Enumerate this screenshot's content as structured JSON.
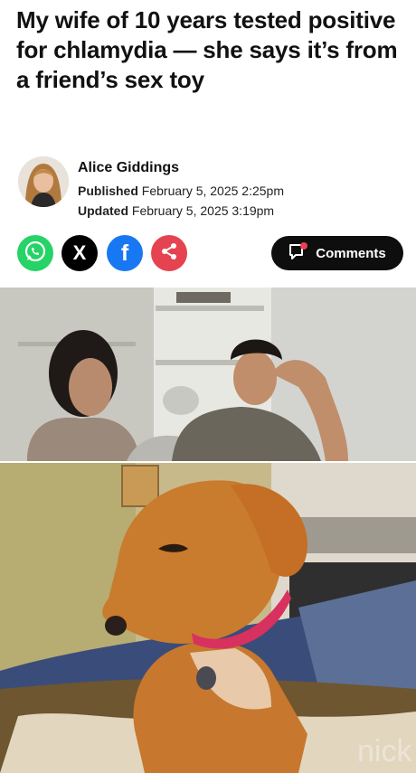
{
  "article": {
    "headline": "My wife of 10 years tested positive for chlamydia — she says it’s from a friend’s sex toy",
    "author": "Alice Giddings",
    "published_label": "Published",
    "published_date": "February 5, 2025 2:25pm",
    "updated_label": "Updated",
    "updated_date": "February 5, 2025 3:19pm"
  },
  "share": {
    "icons": [
      "whatsapp-icon",
      "x-icon",
      "facebook-icon",
      "share-icon"
    ],
    "colors": {
      "whatsapp": "#25d366",
      "x": "#000000",
      "facebook": "#1877f2",
      "share": "#e5434f"
    },
    "x_glyph": "X",
    "facebook_glyph": "f"
  },
  "comments": {
    "label": "Comments",
    "icon": "comment-icon",
    "dot_color": "#e5434f"
  },
  "images": {
    "photo1": "couple sitting apart on a couch",
    "photo2": "dachshund with pink collar on a blanket",
    "watermark": "nick"
  }
}
